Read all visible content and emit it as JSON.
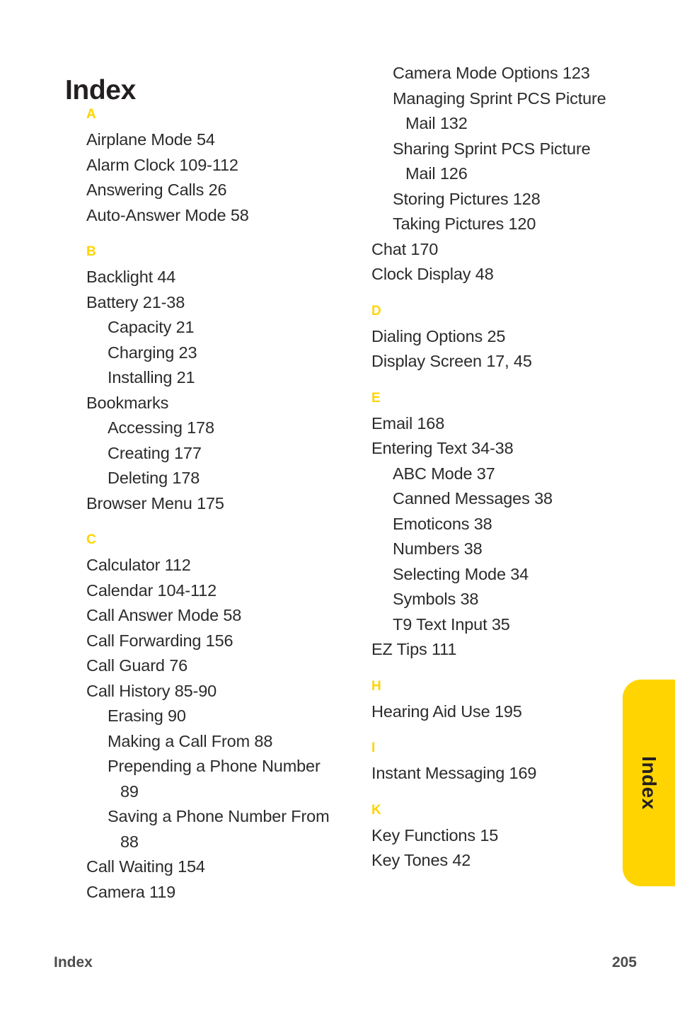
{
  "page": {
    "title": "Index",
    "background_color": "#ffffff",
    "accent_color": "#ffd400",
    "text_color": "#2b2b2b"
  },
  "side_tab": {
    "label": "Index",
    "color": "#ffd400"
  },
  "footer": {
    "left_label": "Index",
    "page_number": "205"
  },
  "columns": [
    {
      "id": "left",
      "sections": [
        {
          "letter": "A",
          "entries": [
            {
              "text": "Airplane Mode 54",
              "level": 1
            },
            {
              "text": "Alarm Clock 109-112",
              "level": 1
            },
            {
              "text": "Answering Calls 26",
              "level": 1
            },
            {
              "text": "Auto-Answer Mode 58",
              "level": 1
            }
          ]
        },
        {
          "letter": "B",
          "entries": [
            {
              "text": "Backlight 44",
              "level": 1
            },
            {
              "text": "Battery 21-38",
              "level": 1
            },
            {
              "text": "Capacity 21",
              "level": 2
            },
            {
              "text": "Charging 23",
              "level": 2
            },
            {
              "text": "Installing 21",
              "level": 2
            },
            {
              "text": "Bookmarks",
              "level": 1
            },
            {
              "text": "Accessing 178",
              "level": 2
            },
            {
              "text": "Creating 177",
              "level": 2
            },
            {
              "text": "Deleting 178",
              "level": 2
            },
            {
              "text": "Browser Menu 175",
              "level": 1
            }
          ]
        },
        {
          "letter": "C",
          "entries": [
            {
              "text": "Calculator 112",
              "level": 1
            },
            {
              "text": "Calendar 104-112",
              "level": 1
            },
            {
              "text": "Call Answer Mode 58",
              "level": 1
            },
            {
              "text": "Call Forwarding 156",
              "level": 1
            },
            {
              "text": "Call Guard 76",
              "level": 1
            },
            {
              "text": "Call History 85-90",
              "level": 1
            },
            {
              "text": "Erasing 90",
              "level": 2
            },
            {
              "text": "Making a Call From 88",
              "level": 2
            },
            {
              "text": "Prepending a Phone Number 89",
              "level": 2
            },
            {
              "text": "Saving a Phone Number From 88",
              "level": 2
            },
            {
              "text": "Call Waiting 154",
              "level": 1
            },
            {
              "text": "Camera 119",
              "level": 1
            }
          ]
        }
      ]
    },
    {
      "id": "right",
      "sections": [
        {
          "letter": "",
          "entries": [
            {
              "text": "Camera Mode Options 123",
              "level": 2
            },
            {
              "text": "Managing Sprint PCS Picture Mail 132",
              "level": 2
            },
            {
              "text": "Sharing Sprint PCS Picture Mail 126",
              "level": 2
            },
            {
              "text": "Storing Pictures 128",
              "level": 2
            },
            {
              "text": "Taking Pictures 120",
              "level": 2
            },
            {
              "text": "Chat 170",
              "level": 1
            },
            {
              "text": "Clock Display 48",
              "level": 1
            }
          ]
        },
        {
          "letter": "D",
          "entries": [
            {
              "text": "Dialing Options 25",
              "level": 1
            },
            {
              "text": "Display Screen 17, 45",
              "level": 1
            }
          ]
        },
        {
          "letter": "E",
          "entries": [
            {
              "text": "Email 168",
              "level": 1
            },
            {
              "text": "Entering Text 34-38",
              "level": 1
            },
            {
              "text": "ABC Mode 37",
              "level": 2
            },
            {
              "text": "Canned Messages 38",
              "level": 2
            },
            {
              "text": "Emoticons 38",
              "level": 2
            },
            {
              "text": "Numbers 38",
              "level": 2
            },
            {
              "text": "Selecting Mode 34",
              "level": 2
            },
            {
              "text": "Symbols 38",
              "level": 2
            },
            {
              "text": "T9 Text Input 35",
              "level": 2
            },
            {
              "text": "EZ Tips 111",
              "level": 1
            }
          ]
        },
        {
          "letter": "H",
          "entries": [
            {
              "text": "Hearing Aid Use 195",
              "level": 1
            }
          ]
        },
        {
          "letter": "I",
          "entries": [
            {
              "text": "Instant Messaging 169",
              "level": 1
            }
          ]
        },
        {
          "letter": "K",
          "entries": [
            {
              "text": "Key Functions 15",
              "level": 1
            },
            {
              "text": "Key Tones 42",
              "level": 1
            }
          ]
        }
      ]
    }
  ]
}
